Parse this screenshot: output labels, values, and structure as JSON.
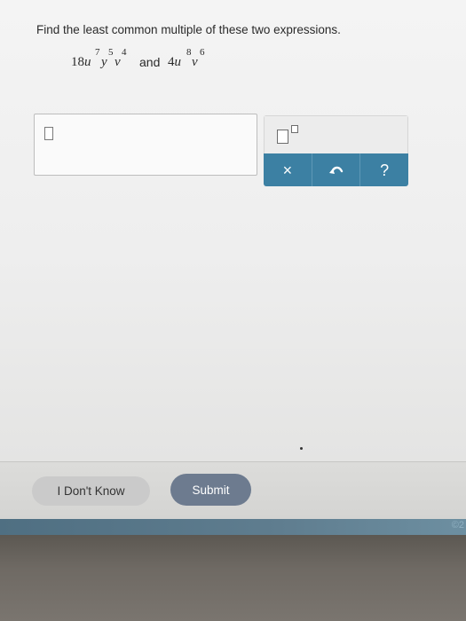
{
  "question": {
    "prompt": "Find the least common multiple of these two expressions.",
    "expr1": {
      "coef": "18",
      "v1": "u",
      "e1": "7",
      "v2": "y",
      "e2": "5",
      "v3": "v",
      "e3": "4"
    },
    "conj": "and",
    "expr2": {
      "coef": "4",
      "v1": "u",
      "e1": "8",
      "v2": "v",
      "e2": "6"
    }
  },
  "palette": {
    "exponent_icon": "superscript-template-icon",
    "clear_glyph": "×",
    "undo_icon": "undo-arrow-icon",
    "help_glyph": "?"
  },
  "footer": {
    "dont_know_label": "I Don't Know",
    "submit_label": "Submit",
    "strip_text": "©2"
  },
  "colors": {
    "palette_blue": "#3c80a3",
    "submit_gray_blue": "#6d7b8f"
  }
}
